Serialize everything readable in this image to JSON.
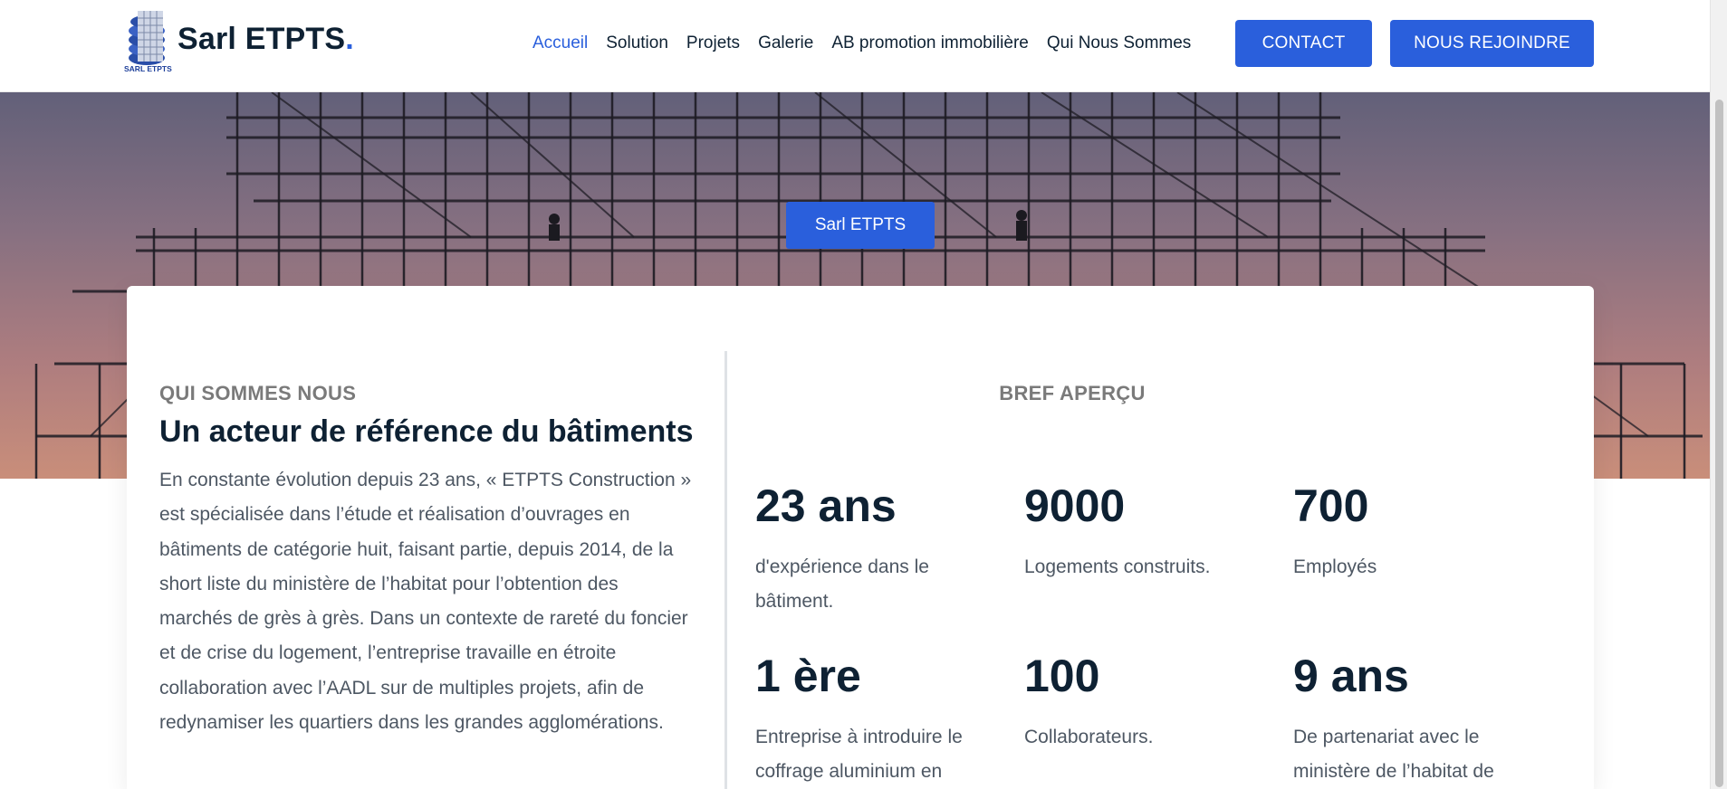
{
  "header": {
    "brand_name": "Sarl ETPTS",
    "brand_dot": ".",
    "logo_text": "SARL ETPTS",
    "nav": [
      {
        "label": "Accueil",
        "active": true
      },
      {
        "label": "Solution",
        "active": false
      },
      {
        "label": "Projets",
        "active": false
      },
      {
        "label": "Galerie",
        "active": false
      },
      {
        "label": "AB promotion immobilière",
        "active": false
      },
      {
        "label": "Qui Nous Sommes",
        "active": false
      }
    ],
    "contact_label": "CONTACT",
    "join_label": "NOUS REJOINDRE"
  },
  "hero": {
    "badge_label": "Sarl ETPTS"
  },
  "about": {
    "kicker": "QUI SOMMES NOUS",
    "title": "Un acteur de référence du bâtiments",
    "paragraph": "En constante évolution depuis 23 ans, « ETPTS Construction » est spécialisée dans l’étude et réalisation d’ouvrages en bâtiments de catégorie huit, faisant partie, depuis 2014, de la short liste du ministère de l’habitat pour l’obtention des marchés de grès à grès. Dans un contexte de rareté du foncier et de crise du logement, l’entreprise travaille en étroite collaboration avec l’AADL sur de multiples projets, afin de redynamiser les quartiers dans les grandes agglomérations."
  },
  "overview": {
    "title": "BREF APERÇU",
    "stats": [
      {
        "number": "23 ans",
        "label": "d'expérience dans le bâtiment."
      },
      {
        "number": "9000",
        "label": "Logements construits."
      },
      {
        "number": "700",
        "label": "Employés"
      },
      {
        "number": "1 ère",
        "label": "Entreprise à introduire le coffrage aluminium en"
      },
      {
        "number": "100",
        "label": "Collaborateurs."
      },
      {
        "number": "9 ans",
        "label": "De partenariat avec le ministère de l’habitat de"
      }
    ]
  },
  "colors": {
    "accent": "#2a5fdc",
    "heading": "#0e2133",
    "body_text": "#4d5763",
    "muted": "#7a7a7a"
  }
}
